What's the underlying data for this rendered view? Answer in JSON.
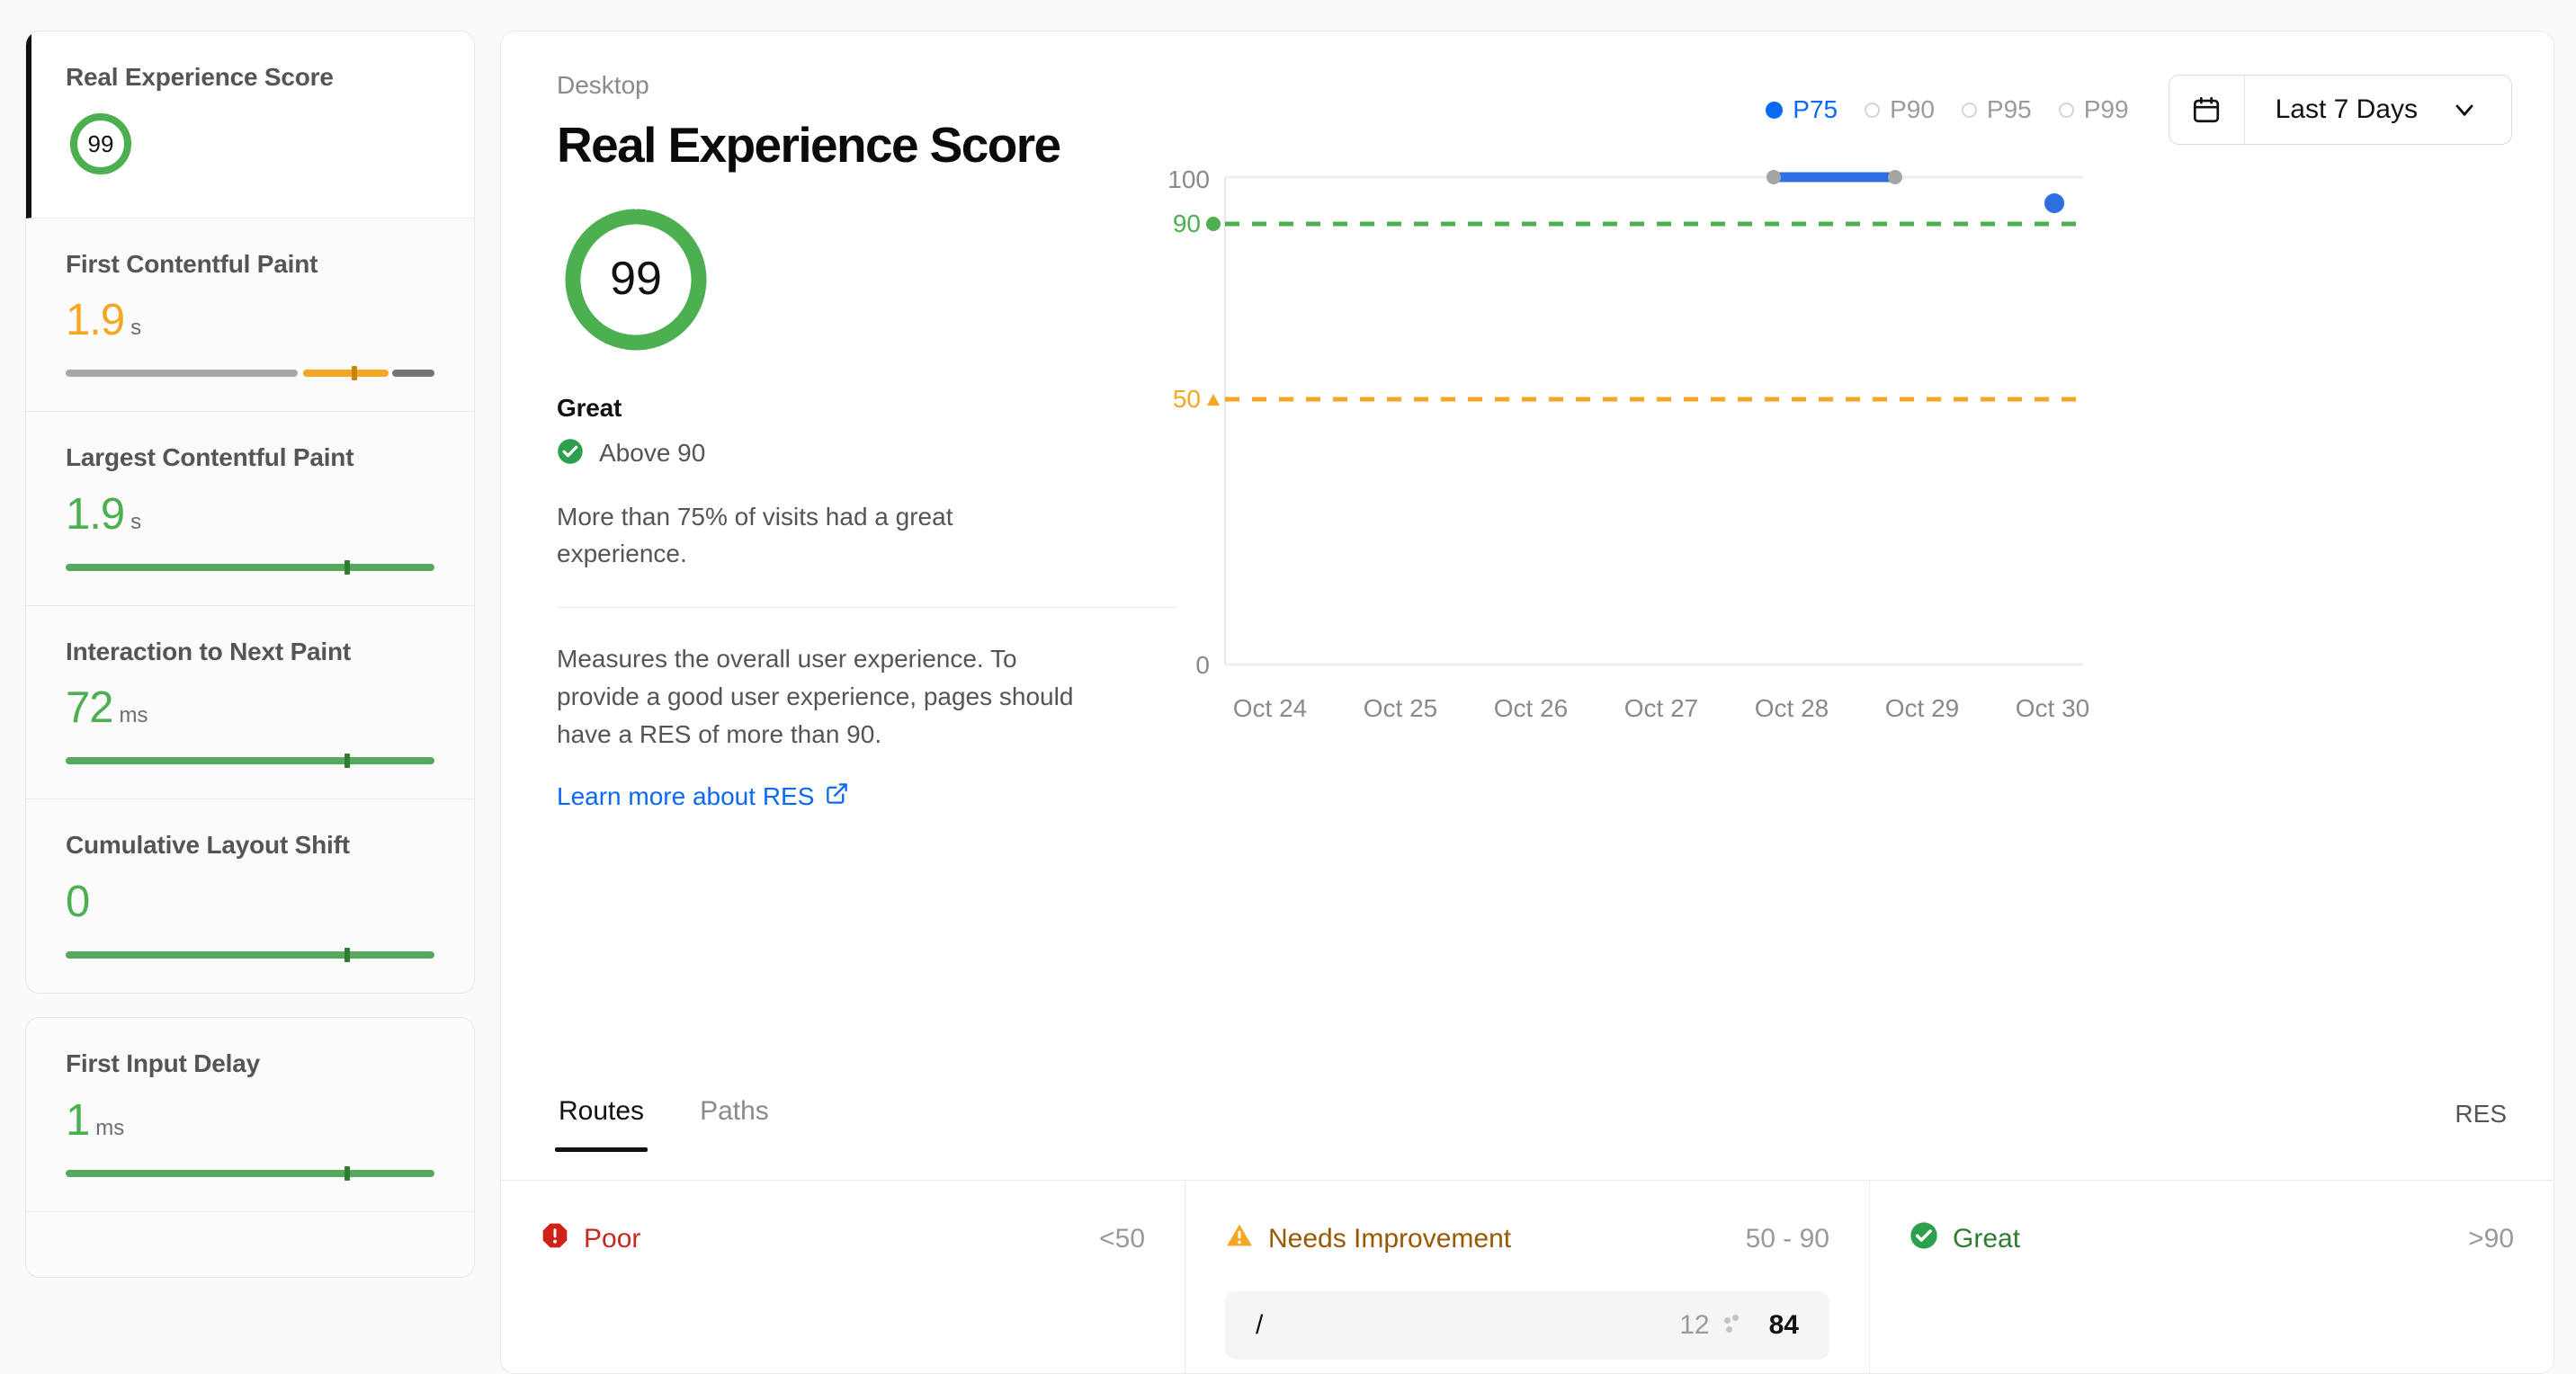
{
  "sidebar": {
    "groups": [
      {
        "cards": [
          {
            "title": "Real Experience Score",
            "kind": "gauge",
            "score": "99"
          },
          {
            "title": "First Contentful Paint",
            "value": "1.9",
            "unit": "s",
            "status": "amber"
          },
          {
            "title": "Largest Contentful Paint",
            "value": "1.9",
            "unit": "s",
            "status": "green"
          },
          {
            "title": "Interaction to Next Paint",
            "value": "72",
            "unit": "ms",
            "status": "green"
          },
          {
            "title": "Cumulative Layout Shift",
            "value": "0",
            "unit": "",
            "status": "green"
          }
        ]
      },
      {
        "cards": [
          {
            "title": "First Input Delay",
            "value": "1",
            "unit": "ms",
            "status": "green"
          }
        ]
      }
    ]
  },
  "main": {
    "device_label": "Desktop",
    "title": "Real Experience Score",
    "score": "99",
    "verdict": "Great",
    "verdict_sub": "Above 90",
    "description": "More than 75% of visits had a great experience.",
    "description2": "Measures the overall user experience. To provide a good user experience, pages should have a RES of more than 90.",
    "learn_more": "Learn more about RES"
  },
  "controls": {
    "percentiles": [
      {
        "label": "P75",
        "selected": true
      },
      {
        "label": "P90",
        "selected": false
      },
      {
        "label": "P95",
        "selected": false
      },
      {
        "label": "P99",
        "selected": false
      }
    ],
    "date_range": "Last 7 Days"
  },
  "chart_data": {
    "type": "line",
    "title": "",
    "xlabel": "",
    "ylabel": "",
    "ylim": [
      0,
      100
    ],
    "yticks": [
      "0",
      "50",
      "90",
      "100"
    ],
    "grid": false,
    "legend": "none",
    "categories": [
      "Oct 24",
      "Oct 25",
      "Oct 26",
      "Oct 27",
      "Oct 28",
      "Oct 29",
      "Oct 30"
    ],
    "series": [
      {
        "name": "P75 Real Experience Score",
        "color": "#2d6fe0",
        "x": [
          "Oct 28",
          "Oct 29",
          "Oct 30"
        ],
        "values": [
          100,
          100,
          97
        ]
      }
    ],
    "thresholds": [
      {
        "label": "90",
        "value": 90,
        "color": "#4caf50",
        "style": "dashed",
        "marker": "circle"
      },
      {
        "label": "50",
        "value": 50,
        "color": "#f5a623",
        "style": "dashed",
        "marker": "triangle"
      }
    ]
  },
  "tabs": [
    {
      "label": "Routes",
      "active": true
    },
    {
      "label": "Paths",
      "active": false
    }
  ],
  "table": {
    "score_column_header": "RES",
    "buckets": [
      {
        "name": "Poor",
        "range": "<50",
        "icon": "octagon-exclamation-icon",
        "color": "#c9281f",
        "rows": []
      },
      {
        "name": "Needs Improvement",
        "range": "50 - 90",
        "icon": "warning-triangle-icon",
        "color": "#9a5800",
        "rows": [
          {
            "path": "/",
            "count": "12",
            "score": "84"
          }
        ]
      },
      {
        "name": "Great",
        "range": ">90",
        "icon": "check-circle-icon",
        "color": "#2e7d32",
        "rows": []
      }
    ]
  },
  "colors": {
    "accent_blue": "#0a69f5",
    "series_blue": "#2d6fe0",
    "green": "#4caf50",
    "amber": "#f5a623",
    "red": "#c9281f",
    "text": "#111111"
  }
}
